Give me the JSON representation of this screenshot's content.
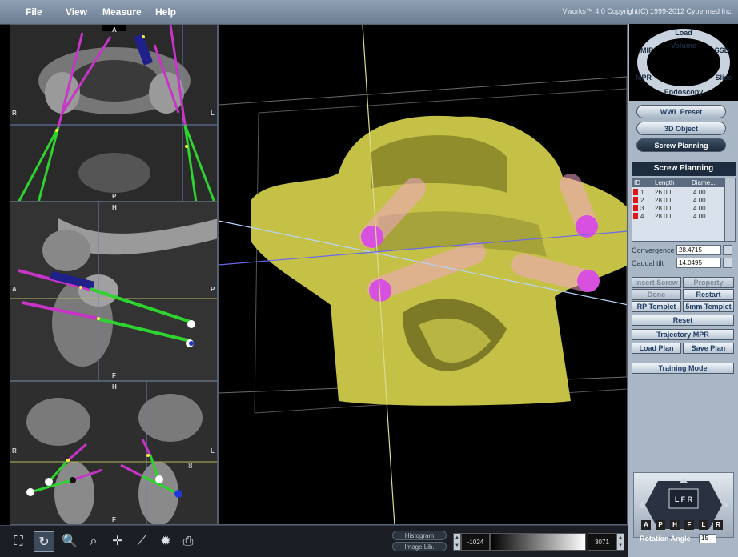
{
  "app": {
    "copyright": "Vworks™ 4.0  Copyright(C) 1999-2012 Cybermed Inc."
  },
  "menu": [
    "File",
    "View",
    "Measure",
    "Help"
  ],
  "viewports": {
    "axial": {
      "labels": [
        "A",
        "P",
        "R",
        "L"
      ]
    },
    "sagittal": {
      "labels": [
        "H",
        "F",
        "A",
        "P"
      ]
    },
    "coronal": {
      "labels": [
        "H",
        "F",
        "R",
        "L"
      ]
    }
  },
  "mode_wheel": [
    "Load",
    "Volume",
    "MIP",
    "SSD",
    "MPR",
    "Slice",
    "Endoscopy"
  ],
  "panel": {
    "wwl_preset": "WWL Preset",
    "object_3d": "3D Object",
    "screw_planning_btn": "Screw Planning",
    "screw_planning_title": "Screw Planning",
    "table": {
      "headers": [
        "ID",
        "Length",
        "Diame..."
      ],
      "rows": [
        {
          "id": "1",
          "length": "26.00",
          "diameter": "4.00"
        },
        {
          "id": "2",
          "length": "28.00",
          "diameter": "4.00"
        },
        {
          "id": "3",
          "length": "28.00",
          "diameter": "4.00"
        },
        {
          "id": "4",
          "length": "28.00",
          "diameter": "4.00"
        }
      ]
    },
    "convergence_label": "Convergence",
    "convergence_value": "28.4715",
    "caudal_label": "Caudal tilt",
    "caudal_value": "14.0495",
    "buttons": {
      "insert_screw": "Insert Screw",
      "property": "Property",
      "done": "Done",
      "restart": "Restart",
      "rp_templet": "RP Templet",
      "fmm_templet": "5mm Templet",
      "reset": "Reset",
      "trajectory_mpr": "Trajectory MPR",
      "load_plan": "Load Plan",
      "save_plan": "Save Plan",
      "training_mode": "Training Mode"
    },
    "nav_face": "L F R",
    "directions": [
      "A",
      "P",
      "H",
      "F",
      "L",
      "R"
    ],
    "rotation_label": "Rotation Angle",
    "rotation_value": "15"
  },
  "toolbar": {
    "histogram": "Histogram",
    "image_lib": "Image Lib.",
    "wl_min": "-1024",
    "wl_max": "3071",
    "tools": [
      "fit-icon",
      "rotate-icon",
      "zoom-icon",
      "magnifier-icon",
      "pan-icon",
      "measure-icon",
      "brightness-icon",
      "capture-icon"
    ]
  },
  "colors": {
    "menubar": "#7b8aa0",
    "panel": "#a9b6c5",
    "bone": "#c5c146",
    "screw_trajectory": "#2fd32f",
    "screw_body": "#c833c8",
    "screw_head": "#d850e0",
    "screw_id_marker": "#e01616"
  }
}
